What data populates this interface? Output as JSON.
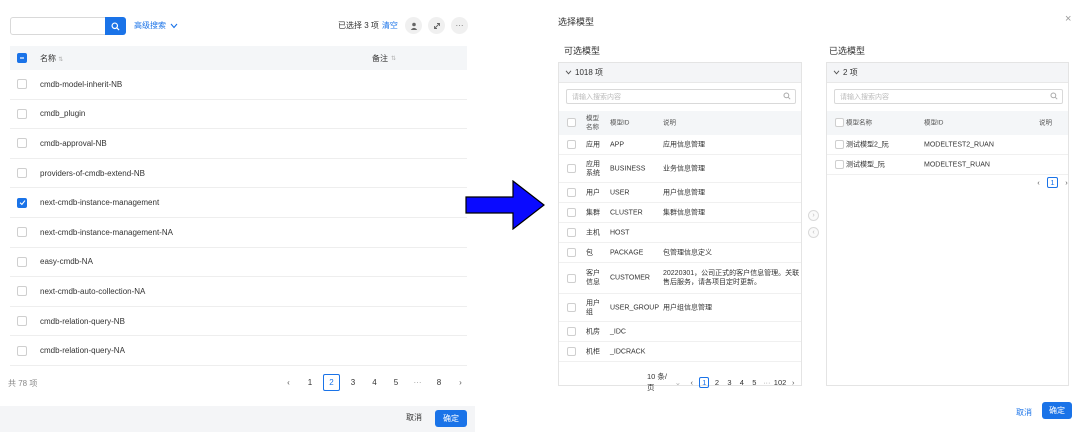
{
  "left": {
    "search": {
      "placeholder": ""
    },
    "advanced_search": "高级搜索",
    "selected_prefix": "已选择 3 项",
    "clear": "清空",
    "table": {
      "col_name": "名称",
      "col_note": "备注",
      "rows": [
        {
          "name": "cmdb-model-inherit-NB",
          "checked": false
        },
        {
          "name": "cmdb_plugin",
          "checked": false
        },
        {
          "name": "cmdb-approval-NB",
          "checked": false
        },
        {
          "name": "providers-of-cmdb-extend-NB",
          "checked": false
        },
        {
          "name": "next-cmdb-instance-management",
          "checked": true
        },
        {
          "name": "next-cmdb-instance-management-NA",
          "checked": false
        },
        {
          "name": "easy-cmdb-NA",
          "checked": false
        },
        {
          "name": "next-cmdb-auto-collection-NA",
          "checked": false
        },
        {
          "name": "cmdb-relation-query-NB",
          "checked": false
        },
        {
          "name": "cmdb-relation-query-NA",
          "checked": false
        }
      ]
    },
    "total": "共 78 项",
    "pager": {
      "prev": "‹",
      "pages": [
        "1",
        "2",
        "3",
        "4",
        "5",
        "···",
        "8"
      ],
      "active": "2",
      "next": "›"
    },
    "footer": {
      "cancel": "取消",
      "ok": "确定"
    }
  },
  "dialog": {
    "title": "选择模型",
    "close": "×",
    "available_title": "可选模型",
    "selected_title": "已选模型",
    "available": {
      "count": "1018 项",
      "search_placeholder": "请输入搜索内容",
      "headers": {
        "name": "模型\n名称",
        "id": "模型ID",
        "desc": "说明"
      },
      "rows": [
        {
          "name": "应用",
          "id": "APP",
          "desc": "应用信息管理"
        },
        {
          "name": "应用\n系统",
          "id": "BUSINESS",
          "desc": "业务信息管理"
        },
        {
          "name": "用户",
          "id": "USER",
          "desc": "用户信息管理"
        },
        {
          "name": "集群",
          "id": "CLUSTER",
          "desc": "集群信息管理"
        },
        {
          "name": "主机",
          "id": "HOST",
          "desc": ""
        },
        {
          "name": "包",
          "id": "PACKAGE",
          "desc": "包管理信息定义"
        },
        {
          "name": "客户\n信息",
          "id": "CUSTOMER",
          "desc": "20220301，公司正式的客户信息管理。关联\n售后服务，请各项目定时更新。"
        },
        {
          "name": "用户\n组",
          "id": "USER_GROUP",
          "desc": "用户组信息管理"
        },
        {
          "name": "机房",
          "id": "_IDC",
          "desc": ""
        },
        {
          "name": "机柜",
          "id": "_IDCRACK",
          "desc": ""
        }
      ],
      "page_size": "10 条/页",
      "pager": {
        "prev": "‹",
        "pages": [
          "1",
          "2",
          "3",
          "4",
          "5",
          "···",
          "102"
        ],
        "active": "1",
        "next": "›"
      }
    },
    "selected": {
      "count": "2 项",
      "search_placeholder": "请输入搜索内容",
      "headers": {
        "name": "模型名称",
        "id": "模型ID",
        "desc": "说明"
      },
      "rows": [
        {
          "name": "测试模型2_阮",
          "id": "MODELTEST2_RUAN",
          "desc": ""
        },
        {
          "name": "测试模型_阮",
          "id": "MODELTEST_RUAN",
          "desc": ""
        }
      ],
      "pager": {
        "prev": "‹",
        "pages": [
          "1"
        ],
        "active": "1",
        "next": "›"
      }
    },
    "move_right": "›",
    "move_left": "‹",
    "footer": {
      "cancel": "取消",
      "ok": "确定"
    }
  },
  "colors": {
    "primary": "#1a73e8",
    "arrow": "#0a0aff"
  }
}
